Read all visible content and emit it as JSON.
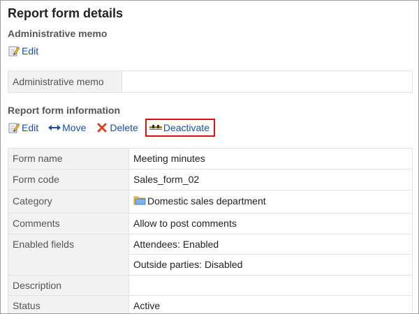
{
  "page": {
    "title": "Report form details"
  },
  "admin_memo": {
    "section_title": "Administrative memo",
    "edit_label": "Edit",
    "row_label": "Administrative memo",
    "row_value": ""
  },
  "info": {
    "section_title": "Report form information",
    "actions": {
      "edit": "Edit",
      "move": "Move",
      "delete": "Delete",
      "deactivate": "Deactivate"
    },
    "rows": {
      "form_name": {
        "label": "Form name",
        "value": "Meeting minutes"
      },
      "form_code": {
        "label": "Form code",
        "value": "Sales_form_02"
      },
      "category": {
        "label": "Category",
        "value": "Domestic sales department"
      },
      "comments": {
        "label": "Comments",
        "value": "Allow to post comments"
      },
      "enabled_fields": {
        "label": "Enabled fields",
        "values": [
          "Attendees: Enabled",
          "Outside parties: Disabled"
        ]
      },
      "description": {
        "label": "Description",
        "value": ""
      },
      "status": {
        "label": "Status",
        "value": "Active"
      }
    }
  },
  "colors": {
    "link": "#1a4fa3",
    "highlight_border": "#d21515",
    "status_active": "#2b8a2b",
    "label_bg": "#f2f2f2"
  },
  "icons": {
    "edit": "edit-icon",
    "move": "move-arrows-icon",
    "delete": "delete-x-icon",
    "deactivate": "deactivate-icon",
    "category": "folder-icon"
  }
}
